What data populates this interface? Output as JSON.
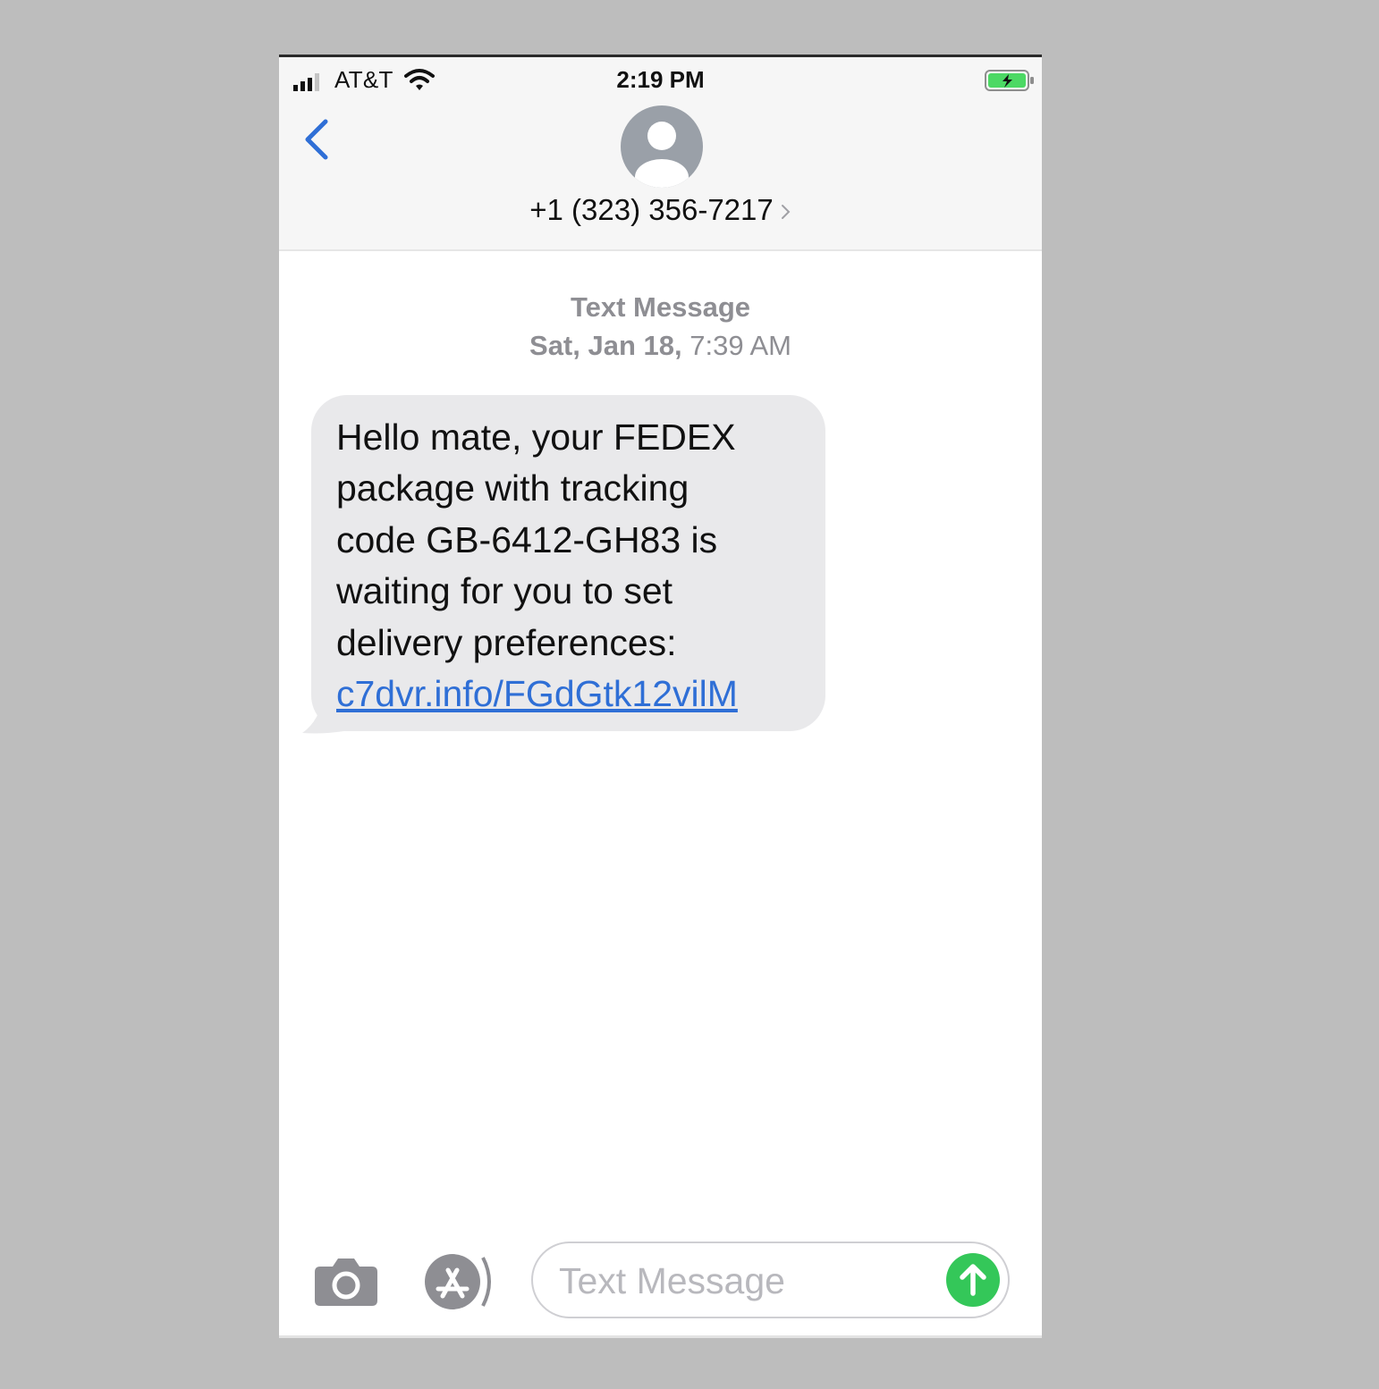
{
  "status_bar": {
    "carrier": "AT&T",
    "time": "2:19 PM"
  },
  "header": {
    "contact": "+1 (323) 356-7217"
  },
  "conversation": {
    "service": "Text Message",
    "date_day": "Sat, Jan 18,",
    "date_time": "7:39 AM",
    "message": {
      "lines": [
        "Hello mate, your FEDEX",
        "package with tracking",
        "code GB-6412-GH83 is",
        "waiting for you to set",
        "delivery preferences:"
      ],
      "link": "c7dvr.info/FGdGtk12vilM"
    }
  },
  "composer": {
    "placeholder": "Text Message"
  },
  "colors": {
    "accent_blue": "#2f6fd6",
    "send_green": "#34c759",
    "bubble_gray": "#e9e9eb",
    "battery_green": "#4cd964"
  }
}
